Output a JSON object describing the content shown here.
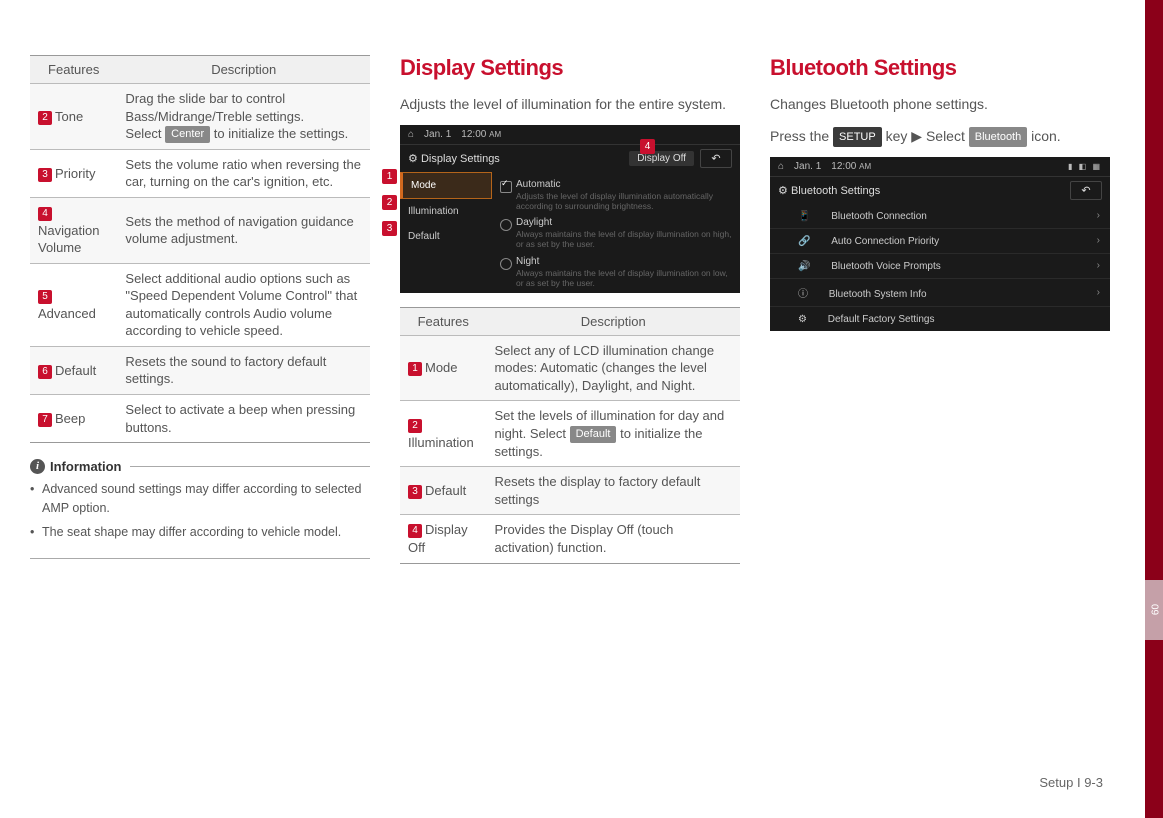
{
  "sidebar_tab": "09",
  "col1": {
    "table": {
      "headers": [
        "Features",
        "Description"
      ],
      "rows": [
        {
          "num": "2",
          "feat": "Tone",
          "desc_a": "Drag the slide bar to control Bass/Midrange/Treble settings.",
          "desc_b": "Select ",
          "btn": "Center",
          "desc_c": " to initialize the settings."
        },
        {
          "num": "3",
          "feat": "Priority",
          "desc": "Sets the volume ratio when reversing the car, turning on the car's ignition, etc."
        },
        {
          "num": "4",
          "feat": "Navigation Volume",
          "desc": "Sets the method of navigation guidance volume adjustment."
        },
        {
          "num": "5",
          "feat": "Advanced",
          "desc": "Select additional audio options such as \"Speed Dependent Volume Control\" that automatically controls Audio volume according to vehicle speed."
        },
        {
          "num": "6",
          "feat": "Default",
          "desc": "Resets the sound to factory default settings."
        },
        {
          "num": "7",
          "feat": "Beep",
          "desc": "Select to activate a beep when pressing buttons."
        }
      ]
    },
    "info_label": "Information",
    "info_items": [
      "Advanced sound settings may differ according to selected AMP option.",
      "The seat shape may differ according to vehicle model."
    ]
  },
  "col2": {
    "heading": "Display Settings",
    "lead": "Adjusts the level of illumination for the entire system.",
    "shot": {
      "date": "Jan. 1",
      "time": "12:00",
      "ampm": "AM",
      "title": "Display Settings",
      "display_off": "Display Off",
      "side": [
        "Mode",
        "Illumination",
        "Default"
      ],
      "opts": [
        {
          "label": "Automatic",
          "sub": "Adjusts the level of display illumination automatically according to surrounding brightness.",
          "checked": true
        },
        {
          "label": "Daylight",
          "sub": "Always maintains the level of display illumination on high, or as set by the user."
        },
        {
          "label": "Night",
          "sub": "Always maintains the level of display illumination on low, or as set by the user."
        }
      ]
    },
    "table": {
      "headers": [
        "Features",
        "Description"
      ],
      "rows": [
        {
          "num": "1",
          "feat": "Mode",
          "desc": "Select any of LCD illumination change modes: Automatic (changes the level automatically), Daylight, and Night."
        },
        {
          "num": "2",
          "feat": "Illumination",
          "desc_a": "Set the levels of illumination for day and night. Select ",
          "btn": "Default",
          "desc_c": " to initialize the settings."
        },
        {
          "num": "3",
          "feat": "Default",
          "desc": "Resets the display to factory default settings"
        },
        {
          "num": "4",
          "feat": "Display Off",
          "desc": "Provides the Display Off (touch activation) function."
        }
      ]
    }
  },
  "col3": {
    "heading": "Bluetooth Settings",
    "lead_a": "Changes Bluetooth phone settings.",
    "lead_b": "Press the ",
    "btn1": "SETUP",
    "lead_c": " key ▶ Select ",
    "btn2": "Bluetooth",
    "lead_d": " icon.",
    "shot": {
      "date": "Jan. 1",
      "time": "12:00",
      "ampm": "AM",
      "title": "Bluetooth Settings",
      "items": [
        "Bluetooth Connection",
        "Auto Connection Priority",
        "Bluetooth Voice Prompts",
        "Bluetooth System Info",
        "Default Factory Settings"
      ]
    }
  },
  "footer": "Setup I 9-3"
}
